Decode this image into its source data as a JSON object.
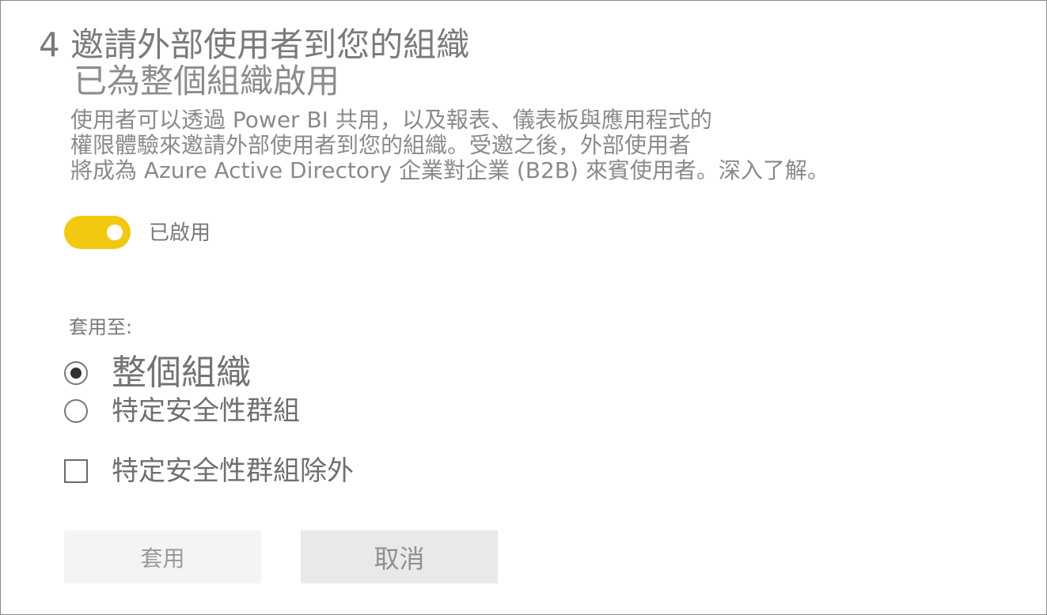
{
  "section": {
    "title": "4 邀請外部使用者到您的組織",
    "status_heading": "已為整個組織啟用",
    "description_lines": [
      "使用者可以透過 Power BI 共用，以及報表、儀表板與應用程式的",
      "權限體驗來邀請外部使用者到您的組織。受邀之後，外部使用者",
      "將成為 Azure Active Directory 企業對企業 (B2B) 來賓使用者。深入了解。"
    ]
  },
  "toggle": {
    "state": "on",
    "label": "已啟用",
    "color": "#f2c811"
  },
  "apply_to": {
    "label": "套用至:",
    "options": [
      {
        "label": "整個組織",
        "selected": true
      },
      {
        "label": "特定安全性群組",
        "selected": false
      }
    ],
    "exclude": {
      "label": "特定安全性群組除外",
      "checked": false
    }
  },
  "buttons": {
    "apply": "套用",
    "cancel": "取消"
  }
}
